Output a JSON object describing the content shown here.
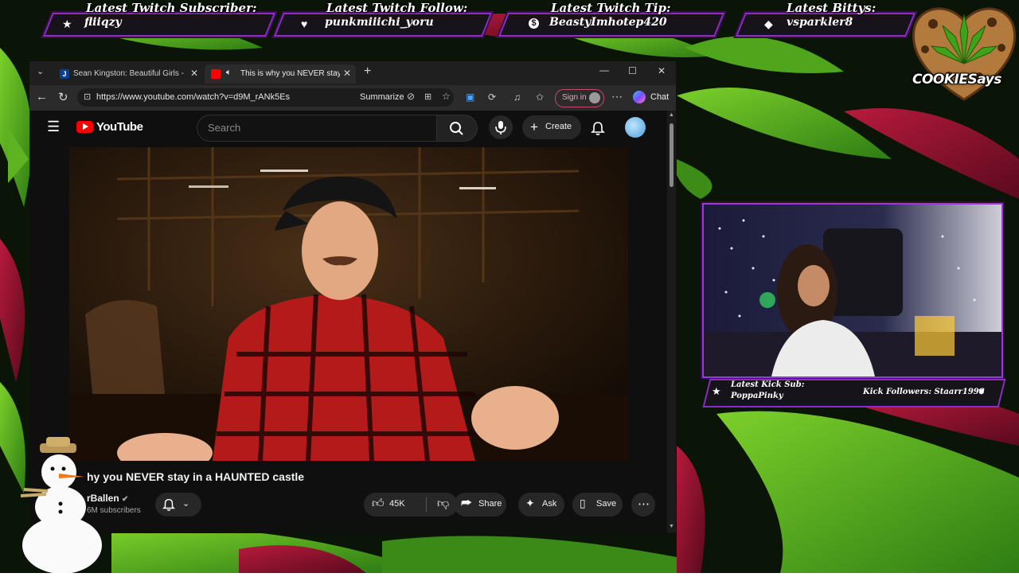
{
  "overlay": {
    "alerts": [
      {
        "title": "Latest Twitch Subscriber:",
        "value": "fliiqzy",
        "icon": "star-icon"
      },
      {
        "title": "Latest Twitch Follow:",
        "value": "punkmiiichi_yoru",
        "icon": "heart-icon"
      },
      {
        "title": "Latest Twitch Tip:",
        "value": "BeastyImhotep420",
        "icon": "dollar-icon"
      },
      {
        "title": "Latest Bittys:",
        "value": "vsparkler8",
        "icon": "diamond-icon"
      }
    ],
    "brand": "COOKIESays",
    "kick": {
      "sub_title": "Latest Kick Sub:",
      "sub_value": "PoppaPinky",
      "followers": "Kick Followers: Staarr1998"
    }
  },
  "browser": {
    "tabs": [
      {
        "label": "Sean Kingston: Beautiful Girls - Jam",
        "active": false
      },
      {
        "label": "This is why you NEVER stay in",
        "active": true
      }
    ],
    "url": "https://www.youtube.com/watch?v=d9M_rANk5Es",
    "summarize_label": "Summarize",
    "signin_label": "Sign in",
    "chat_label": "Chat"
  },
  "youtube": {
    "logo_text": "YouTube",
    "search_placeholder": "Search",
    "create_label": "Create",
    "video_title": "hy you NEVER stay in a HAUNTED castle",
    "channel_name": "rBallen",
    "subscribers": "6M subscribers",
    "like_count": "45K",
    "share_label": "Share",
    "ask_label": "Ask",
    "save_label": "Save"
  }
}
